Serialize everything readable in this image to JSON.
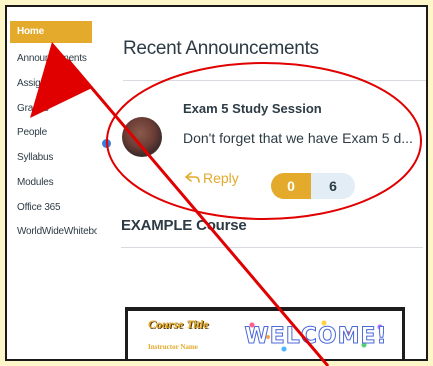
{
  "sidebar": {
    "items": [
      {
        "label": "Home",
        "active": true
      },
      {
        "label": "Announcements"
      },
      {
        "label": "Assignments"
      },
      {
        "label": "Grades"
      },
      {
        "label": "People"
      },
      {
        "label": "Syllabus"
      },
      {
        "label": "Modules"
      },
      {
        "label": "Office 365"
      },
      {
        "label": "WorldWideWhiteboard"
      }
    ]
  },
  "main": {
    "heading": "Recent Announcements",
    "announcement": {
      "title": "Exam 5 Study Session",
      "preview": "Don't forget that we have Exam 5 d...",
      "reply_label": "Reply",
      "unread_count": "0",
      "total_count": "6"
    },
    "course_heading": "EXAMPLE Course",
    "banner": {
      "course_title": "Course Title",
      "instructor": "Instructor Name",
      "welcome": "WELCOME!"
    }
  },
  "colors": {
    "accent": "#e3aa2b",
    "annotation": "#e00000",
    "background": "#fdf6c9"
  },
  "icons": [
    "reply-arrow-icon",
    "unread-dot-icon"
  ]
}
